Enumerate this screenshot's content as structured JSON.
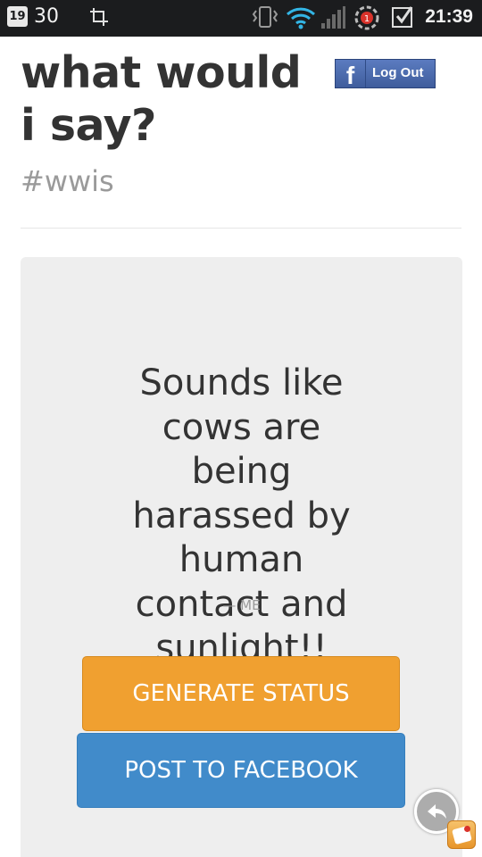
{
  "status_bar": {
    "calendar_day": "19",
    "temperature": "30",
    "time": "21:39",
    "icons": [
      "calendar-icon",
      "screenshot-crop-icon",
      "vibrate-icon",
      "wifi-icon",
      "signal-icon",
      "sync-alert-icon",
      "checkbox-icon"
    ]
  },
  "header": {
    "title": "what would i say?",
    "hashtag": "#wwis",
    "logout_icon": "f",
    "logout_label": "Log Out"
  },
  "card": {
    "quote": "Sounds like cows are being harassed by human contact and sunlight!!",
    "attribution": "— ME",
    "generate_label": "GENERATE STATUS",
    "post_label": "POST TO FACEBOOK"
  },
  "colors": {
    "status_bar_bg": "#1b1c1e",
    "text_dark": "#333333",
    "text_muted": "#9a9a9a",
    "card_bg": "#eeeeee",
    "generate_button": "#f0a030",
    "post_button": "#418bca",
    "facebook_blue": "#3f5d9c"
  }
}
